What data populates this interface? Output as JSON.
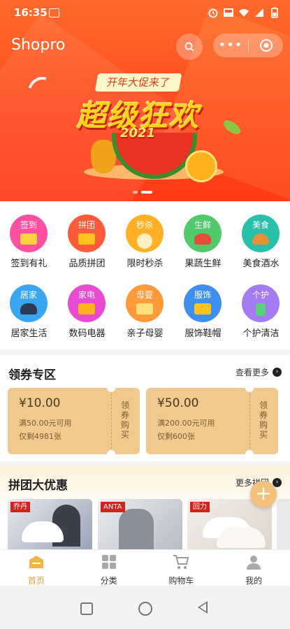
{
  "status_bar": {
    "time": "16:35"
  },
  "header": {
    "brand": "Shopro",
    "more_glyph": "•••"
  },
  "banner": {
    "tag": "开年大促来了",
    "title": "超级狂欢",
    "year": "2021",
    "slide_count": 2,
    "active_slide": 2
  },
  "categories": [
    {
      "tag": "签到",
      "label": "签到有礼",
      "color": "#ff4fa0",
      "icon": "gift-icon"
    },
    {
      "tag": "拼团",
      "label": "品质拼团",
      "color": "#ff5a3a",
      "icon": "bag-icon"
    },
    {
      "tag": "秒杀",
      "label": "限时秒杀",
      "color": "#ffb024",
      "icon": "clock-icon"
    },
    {
      "tag": "生鲜",
      "label": "果蔬生鲜",
      "color": "#52c96a",
      "icon": "vegetable-icon"
    },
    {
      "tag": "美食",
      "label": "美食酒水",
      "color": "#28c0a8",
      "icon": "burger-icon"
    },
    {
      "tag": "居家",
      "label": "居家生活",
      "color": "#3aa6f2",
      "icon": "pot-icon"
    },
    {
      "tag": "家电",
      "label": "数码电器",
      "color": "#e84bd0",
      "icon": "appliance-icon"
    },
    {
      "tag": "母婴",
      "label": "亲子母婴",
      "color": "#ff9a3a",
      "icon": "baby-icon"
    },
    {
      "tag": "服饰",
      "label": "服饰鞋帽",
      "color": "#3f8ff0",
      "icon": "shirt-icon"
    },
    {
      "tag": "个护",
      "label": "个护清洁",
      "color": "#a57bf2",
      "icon": "bottle-icon"
    }
  ],
  "coupons": {
    "title": "领券专区",
    "more": "查看更多",
    "items": [
      {
        "amount": "¥10.00",
        "condition": "满50.00元可用",
        "remaining": "仅剩4981张",
        "claim": "领券购买"
      },
      {
        "amount": "¥50.00",
        "condition": "满200.00元可用",
        "remaining": "仅剩600张",
        "claim": "领券购买"
      }
    ]
  },
  "groupbuy": {
    "title": "拼团大优惠",
    "more": "更多拼团",
    "products": [
      {
        "brand": "乔丹"
      },
      {
        "brand": "ANTA"
      },
      {
        "brand": "回力"
      },
      {
        "brand": ""
      }
    ]
  },
  "fab": {
    "glyph": "+"
  },
  "tabs": [
    {
      "label": "首页",
      "icon": "home-icon",
      "active": true
    },
    {
      "label": "分类",
      "icon": "grid-icon",
      "active": false
    },
    {
      "label": "购物车",
      "icon": "cart-icon",
      "active": false
    },
    {
      "label": "我的",
      "icon": "user-icon",
      "active": false
    }
  ],
  "colors": {
    "accent": "#e0a23a",
    "banner": "#ff4a1f",
    "coupon_bg": "#f0c98e"
  }
}
